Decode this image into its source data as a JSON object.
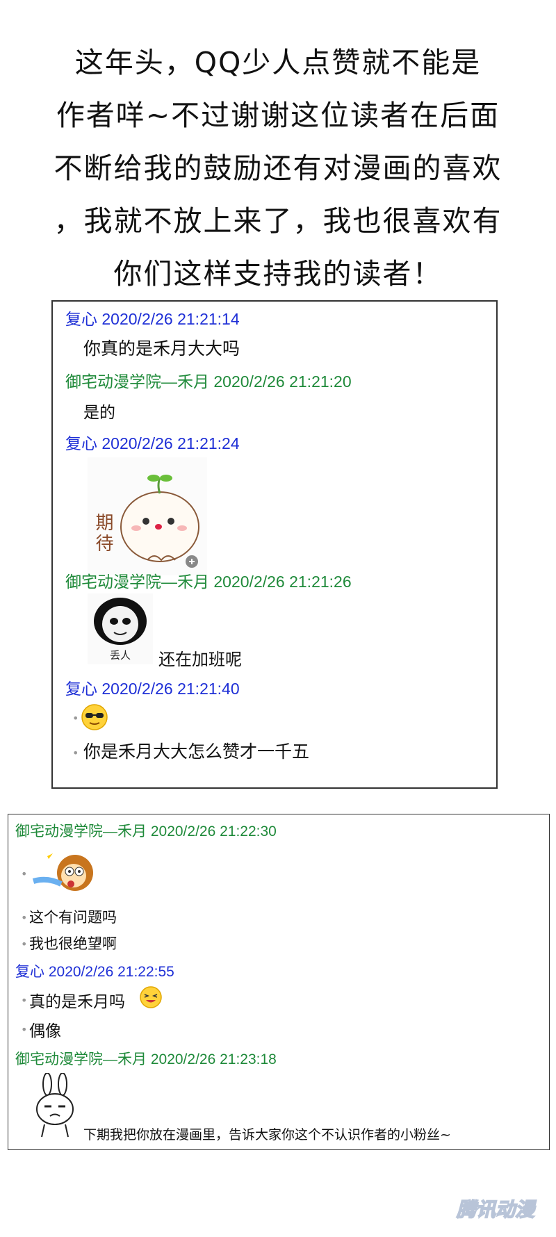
{
  "intro": {
    "lines": [
      "这年头，QQ少人点赞就不能是",
      "作者咩~不过谢谢这位读者在后面",
      "不断给我的鼓励还有对漫画的喜欢",
      "，我就不放上来了，我也很喜欢有",
      "你们这样支持我的读者！"
    ]
  },
  "chat1": {
    "h1": "复心 2020/2/26 21:21:14",
    "m1": "你真的是禾月大大吗",
    "h2": "御宅动漫学院—禾月 2020/2/26 21:21:20",
    "m2": "是的",
    "h3": "复心 2020/2/26 21:21:24",
    "sticker_text": "期待",
    "h4": "御宅动漫学院—禾月 2020/2/26 21:21:26",
    "panda_caption": "丢人",
    "m4": "还在加班呢",
    "h5": "复心 2020/2/26 21:21:40",
    "m5": "你是禾月大大怎么赞才一千五"
  },
  "chat2": {
    "h1": "御宅动漫学院—禾月 2020/2/26 21:22:30",
    "m1": "这个有问题吗",
    "m2": "我也很绝望啊",
    "h2": "复心 2020/2/26 21:22:55",
    "m3": "真的是禾月吗",
    "m4": "偶像",
    "h3": "御宅动漫学院—禾月 2020/2/26 21:23:18",
    "m5": "下期我把你放在漫画里，告诉大家你这个不认识作者的小粉丝~"
  },
  "watermark": "腾讯动漫",
  "colors": {
    "blue_sender": "#1e2fd6",
    "green_sender": "#1f8a3a",
    "border": "#333333"
  }
}
